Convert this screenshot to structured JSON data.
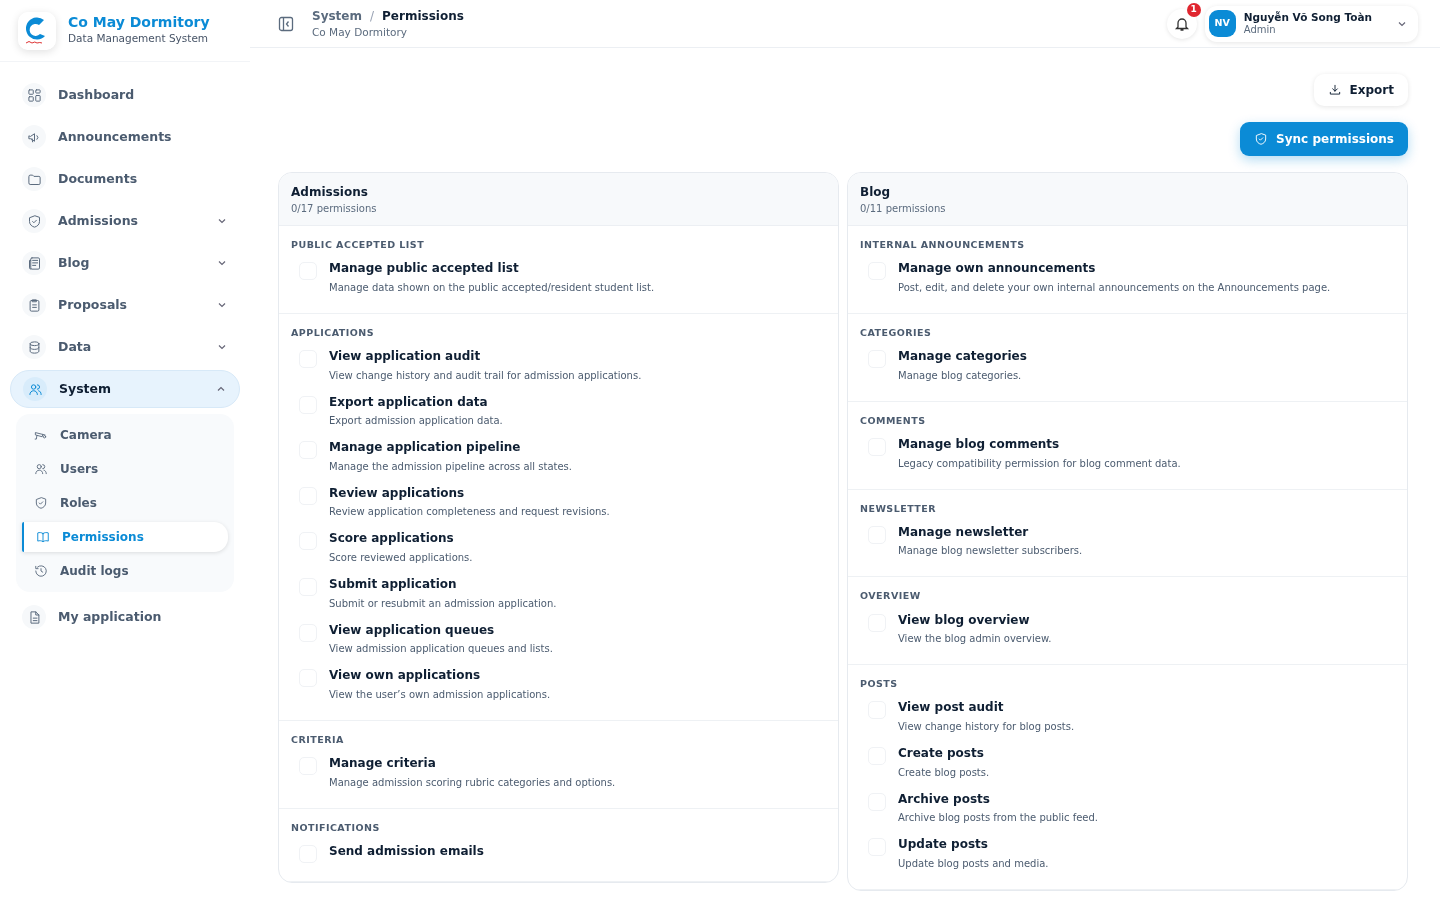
{
  "brand": {
    "title": "Co May Dormitory",
    "subtitle": "Data Management System"
  },
  "sidebar": {
    "items": [
      {
        "label": "Dashboard",
        "selected": false
      },
      {
        "label": "Announcements",
        "selected": false
      },
      {
        "label": "Documents",
        "selected": false
      },
      {
        "label": "Admissions",
        "selected": false,
        "expanded": false
      },
      {
        "label": "Blog",
        "selected": false,
        "expanded": false
      },
      {
        "label": "Proposals",
        "selected": false,
        "expanded": false
      },
      {
        "label": "Data",
        "selected": false,
        "expanded": false
      },
      {
        "label": "System",
        "selected": true,
        "expanded": true,
        "children": [
          {
            "label": "Camera",
            "selected": false
          },
          {
            "label": "Users",
            "selected": false
          },
          {
            "label": "Roles",
            "selected": false
          },
          {
            "label": "Permissions",
            "selected": true
          },
          {
            "label": "Audit logs",
            "selected": false
          }
        ]
      },
      {
        "label": "My application",
        "selected": false
      }
    ]
  },
  "header": {
    "breadcrumb": [
      "System",
      "Permissions"
    ],
    "breadcrumb_separator": "/",
    "subtitle": "Co May Dormitory",
    "notification_count": "1",
    "user": {
      "initials": "NV",
      "name": "Nguyễn Võ Song Toàn",
      "role": "Admin"
    }
  },
  "actions": {
    "export": "Export",
    "sync": "Sync permissions"
  },
  "groups": [
    {
      "title": "Admissions",
      "count": "0/17 permissions",
      "sections": [
        {
          "title": "PUBLIC ACCEPTED LIST",
          "permissions": [
            {
              "name": "Manage public accepted list",
              "description": "Manage data shown on the public accepted/resident student list.",
              "checked": false
            }
          ]
        },
        {
          "title": "APPLICATIONS",
          "permissions": [
            {
              "name": "View application audit",
              "description": "View change history and audit trail for admission applications.",
              "checked": false
            },
            {
              "name": "Export application data",
              "description": "Export admission application data.",
              "checked": false
            },
            {
              "name": "Manage application pipeline",
              "description": "Manage the admission pipeline across all states.",
              "checked": false
            },
            {
              "name": "Review applications",
              "description": "Review application completeness and request revisions.",
              "checked": false
            },
            {
              "name": "Score applications",
              "description": "Score reviewed applications.",
              "checked": false
            },
            {
              "name": "Submit application",
              "description": "Submit or resubmit an admission application.",
              "checked": false
            },
            {
              "name": "View application queues",
              "description": "View admission application queues and lists.",
              "checked": false
            },
            {
              "name": "View own applications",
              "description": "View the user’s own admission applications.",
              "checked": false
            }
          ]
        },
        {
          "title": "CRITERIA",
          "permissions": [
            {
              "name": "Manage criteria",
              "description": "Manage admission scoring rubric categories and options.",
              "checked": false
            }
          ]
        },
        {
          "title": "NOTIFICATIONS",
          "permissions": [
            {
              "name": "Send admission emails",
              "checked": false
            }
          ]
        }
      ]
    },
    {
      "title": "Blog",
      "count": "0/11 permissions",
      "sections": [
        {
          "title": "INTERNAL ANNOUNCEMENTS",
          "permissions": [
            {
              "name": "Manage own announcements",
              "description": "Post, edit, and delete your own internal announcements on the Announcements page.",
              "checked": false
            }
          ]
        },
        {
          "title": "CATEGORIES",
          "permissions": [
            {
              "name": "Manage categories",
              "description": "Manage blog categories.",
              "checked": false
            }
          ]
        },
        {
          "title": "COMMENTS",
          "permissions": [
            {
              "name": "Manage blog comments",
              "description": "Legacy compatibility permission for blog comment data.",
              "checked": false
            }
          ]
        },
        {
          "title": "NEWSLETTER",
          "permissions": [
            {
              "name": "Manage newsletter",
              "description": "Manage blog newsletter subscribers.",
              "checked": false
            }
          ]
        },
        {
          "title": "OVERVIEW",
          "permissions": [
            {
              "name": "View blog overview",
              "description": "View the blog admin overview.",
              "checked": false
            }
          ]
        },
        {
          "title": "POSTS",
          "permissions": [
            {
              "name": "View post audit",
              "description": "View change history for blog posts.",
              "checked": false
            },
            {
              "name": "Create posts",
              "description": "Create blog posts.",
              "checked": false
            },
            {
              "name": "Archive posts",
              "description": "Archive blog posts from the public feed.",
              "checked": false
            },
            {
              "name": "Update posts",
              "description": "Update blog posts and media.",
              "checked": false
            }
          ]
        }
      ]
    }
  ]
}
